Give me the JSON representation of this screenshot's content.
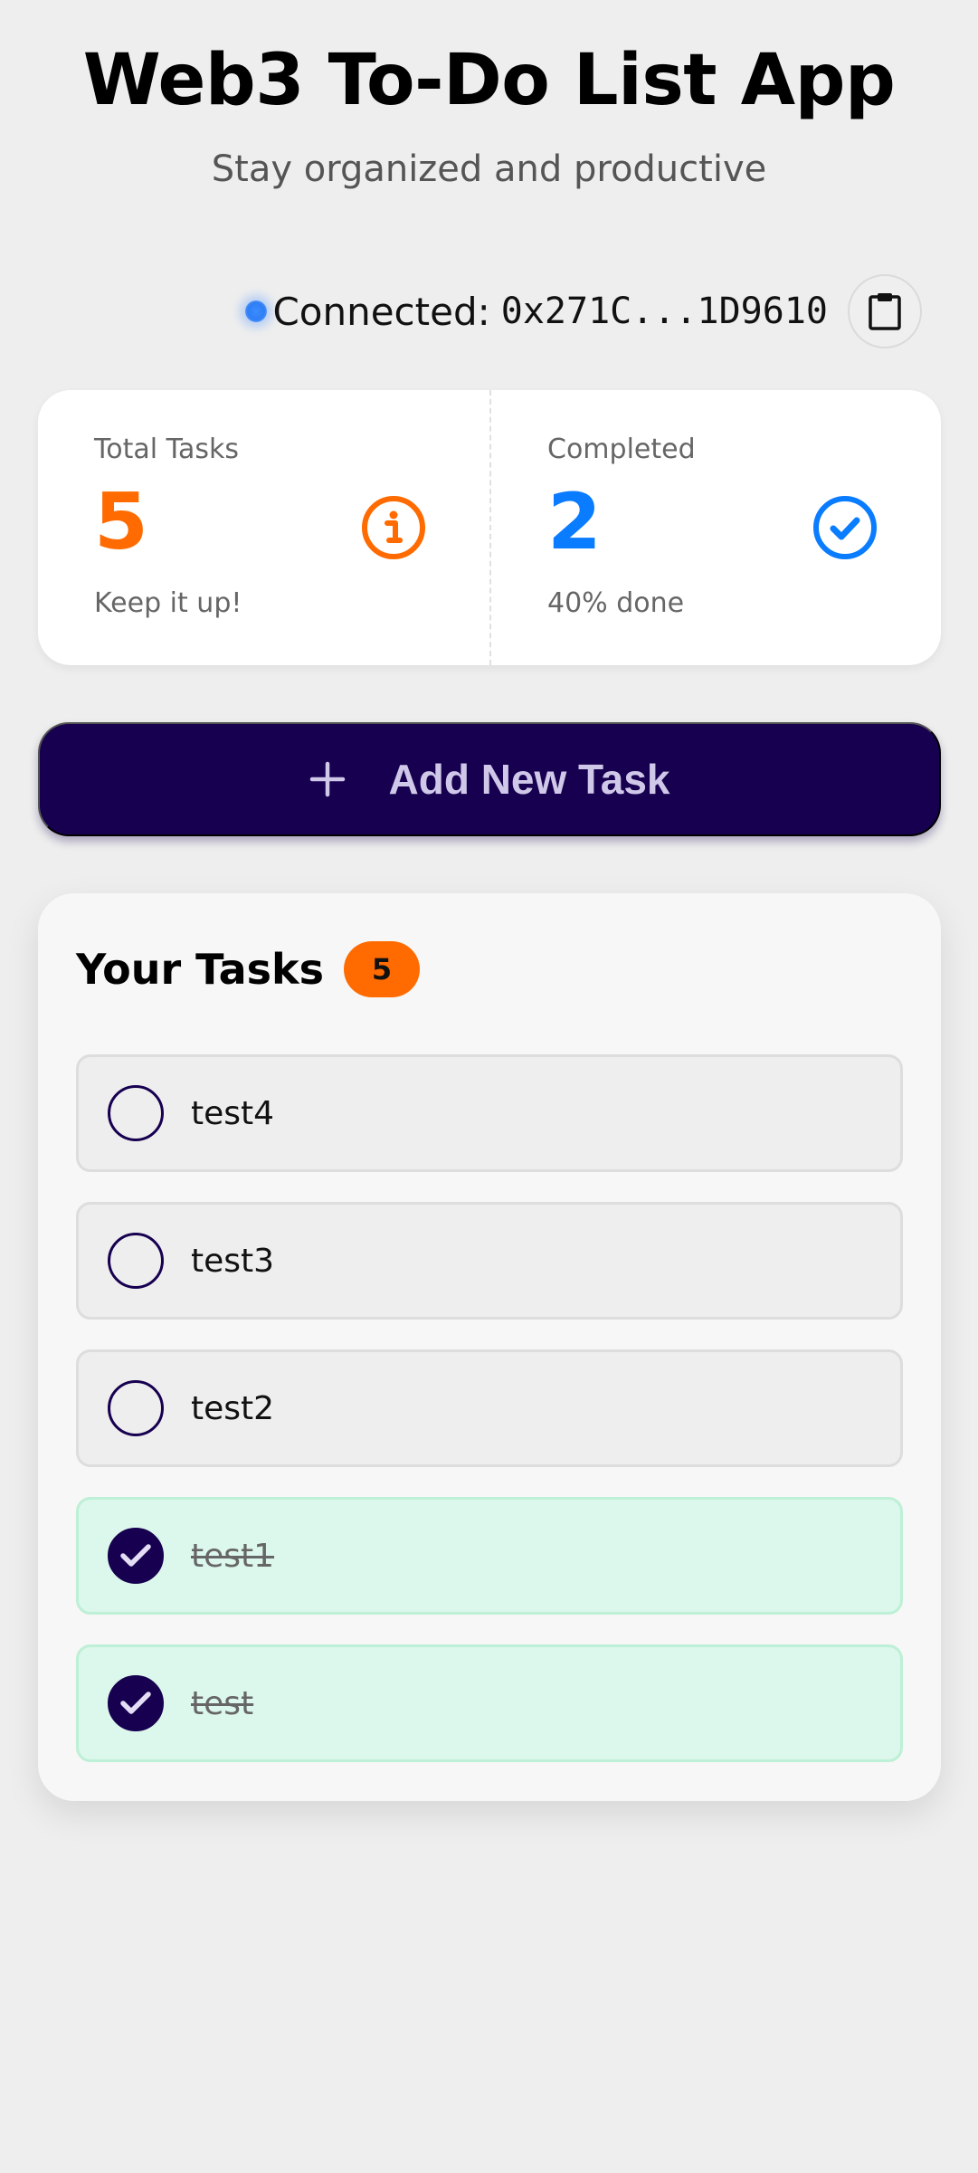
{
  "header": {
    "title": "Web3 To-Do List App",
    "subtitle": "Stay organized and productive"
  },
  "wallet": {
    "label": "Connected:",
    "address": "0x271C...1D9610",
    "status_icon": "status-dot",
    "copy_icon": "clipboard-icon"
  },
  "stats": {
    "total": {
      "label": "Total Tasks",
      "value": "5",
      "note": "Keep it up!",
      "icon": "info-icon",
      "color": "#ff6b00"
    },
    "completed": {
      "label": "Completed",
      "value": "2",
      "note": "40% done",
      "icon": "check-circle-icon",
      "color": "#0a7cff"
    }
  },
  "add_button": {
    "label": "Add New Task",
    "icon": "plus-icon"
  },
  "tasks": {
    "title": "Your Tasks",
    "count": "5",
    "items": [
      {
        "text": "test4",
        "completed": false
      },
      {
        "text": "test3",
        "completed": false
      },
      {
        "text": "test2",
        "completed": false
      },
      {
        "text": "test1",
        "completed": true
      },
      {
        "text": "test",
        "completed": true
      }
    ]
  },
  "colors": {
    "background": "#eeeeee",
    "primary": "#170050",
    "accent_orange": "#ff6b00",
    "accent_blue": "#0a7cff",
    "done_bg": "#dcf7eb"
  }
}
